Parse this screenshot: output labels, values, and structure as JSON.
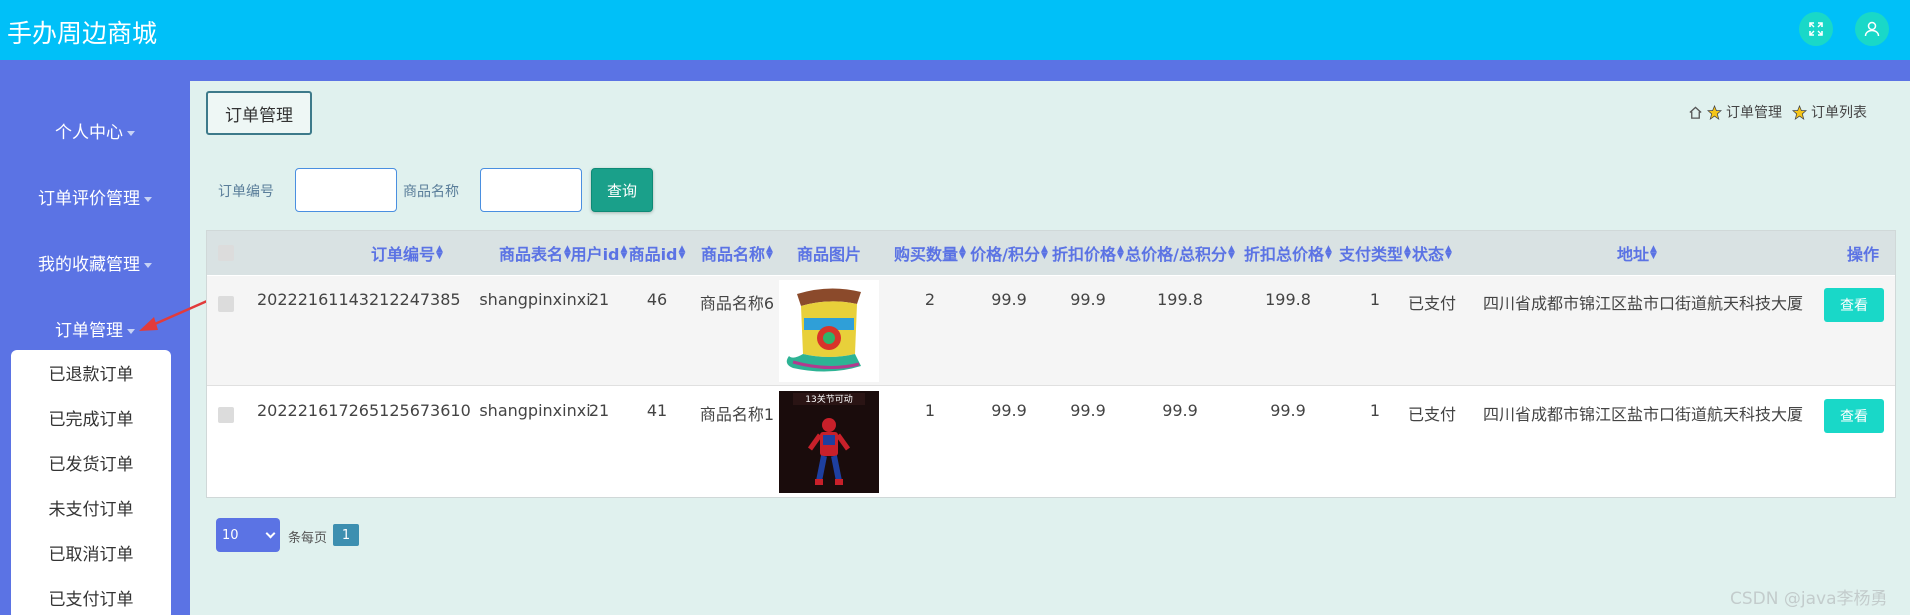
{
  "app": {
    "title": "手办周边商城"
  },
  "colors": {
    "header": "#00c0f8",
    "sidebar": "#5b73e4",
    "accent": "#19d8c8",
    "query": "#1aa08a"
  },
  "header": {
    "icons": [
      "fullscreen-icon",
      "user-icon"
    ]
  },
  "sidebar": {
    "items": [
      {
        "label": "个人中心"
      },
      {
        "label": "订单评价管理"
      },
      {
        "label": "我的收藏管理"
      },
      {
        "label": "订单管理"
      }
    ],
    "submenu": [
      {
        "label": "已退款订单"
      },
      {
        "label": "已完成订单"
      },
      {
        "label": "已发货订单"
      },
      {
        "label": "未支付订单"
      },
      {
        "label": "已取消订单"
      },
      {
        "label": "已支付订单"
      }
    ]
  },
  "page": {
    "title": "订单管理",
    "breadcrumb": [
      "订单管理",
      "订单列表"
    ]
  },
  "search": {
    "order_no_label": "订单编号",
    "order_no_value": "",
    "product_name_label": "商品名称",
    "product_name_value": "",
    "query_label": "查询"
  },
  "table": {
    "columns": [
      "订单编号",
      "商品表名",
      "用户id",
      "商品id",
      "商品名称",
      "商品图片",
      "购买数量",
      "价格/积分",
      "折扣价格",
      "总价格/总积分",
      "折扣总价格",
      "支付类型",
      "状态",
      "地址",
      "操作"
    ],
    "sortable": [
      true,
      true,
      true,
      true,
      true,
      false,
      true,
      true,
      true,
      true,
      true,
      true,
      true,
      true,
      false
    ],
    "rows": [
      {
        "order_no": "20222161143212247385",
        "table_name": "shangpinxinxi",
        "user_id": "21",
        "product_id": "46",
        "product_name": "商品名称6",
        "image": "hat-image",
        "quantity": "2",
        "price": "99.9",
        "discount_price": "99.9",
        "total": "199.8",
        "discount_total": "199.8",
        "pay_type": "1",
        "status": "已支付",
        "address": "四川省成都市锦江区盐市口街道航天科技大厦",
        "action": "查看"
      },
      {
        "order_no": "202221617265125673610",
        "table_name": "shangpinxinxi",
        "user_id": "21",
        "product_id": "41",
        "product_name": "商品名称1",
        "image": "spiderman-figure-image",
        "image_text": "13关节可动",
        "quantity": "1",
        "price": "99.9",
        "discount_price": "99.9",
        "total": "99.9",
        "discount_total": "99.9",
        "pay_type": "1",
        "status": "已支付",
        "address": "四川省成都市锦江区盐市口街道航天科技大厦",
        "action": "查看"
      }
    ]
  },
  "pagination": {
    "page_size": "10",
    "per_page_label": "条每页",
    "current_page": "1"
  },
  "watermark": "CSDN @java李杨勇"
}
